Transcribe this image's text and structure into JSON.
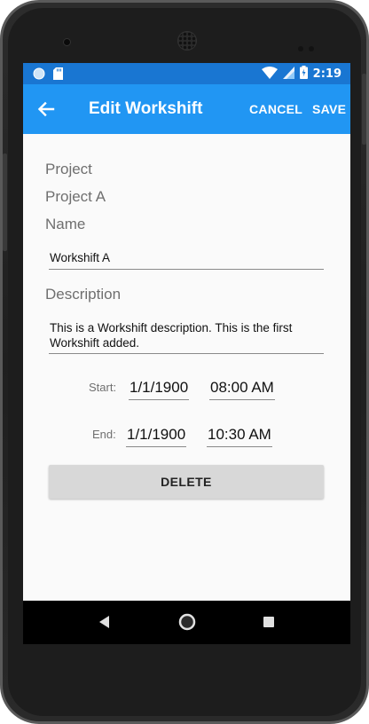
{
  "status_bar": {
    "time": "2:19",
    "icons": [
      "circle-notification-icon",
      "sd-card-icon",
      "wifi-icon",
      "signal-icon",
      "battery-charging-icon"
    ],
    "color": "#1976d2"
  },
  "app_bar": {
    "title": "Edit Workshift",
    "cancel_label": "CANCEL",
    "save_label": "SAVE",
    "back_icon": "back-arrow-icon",
    "color": "#2196f3"
  },
  "form": {
    "project_label": "Project",
    "project_value": "Project A",
    "name_label": "Name",
    "name_value": "Workshift A",
    "description_label": "Description",
    "description_value": "This is a Workshift description. This is the first Workshift added.",
    "start_label": "Start:",
    "start_date": "1/1/1900",
    "start_time": "08:00 AM",
    "end_label": "End:",
    "end_date": "1/1/1900",
    "end_time": "10:30 AM",
    "delete_label": "DELETE"
  },
  "nav_bar": {
    "buttons": [
      "back-triangle-icon",
      "home-circle-icon",
      "recents-square-icon"
    ]
  }
}
